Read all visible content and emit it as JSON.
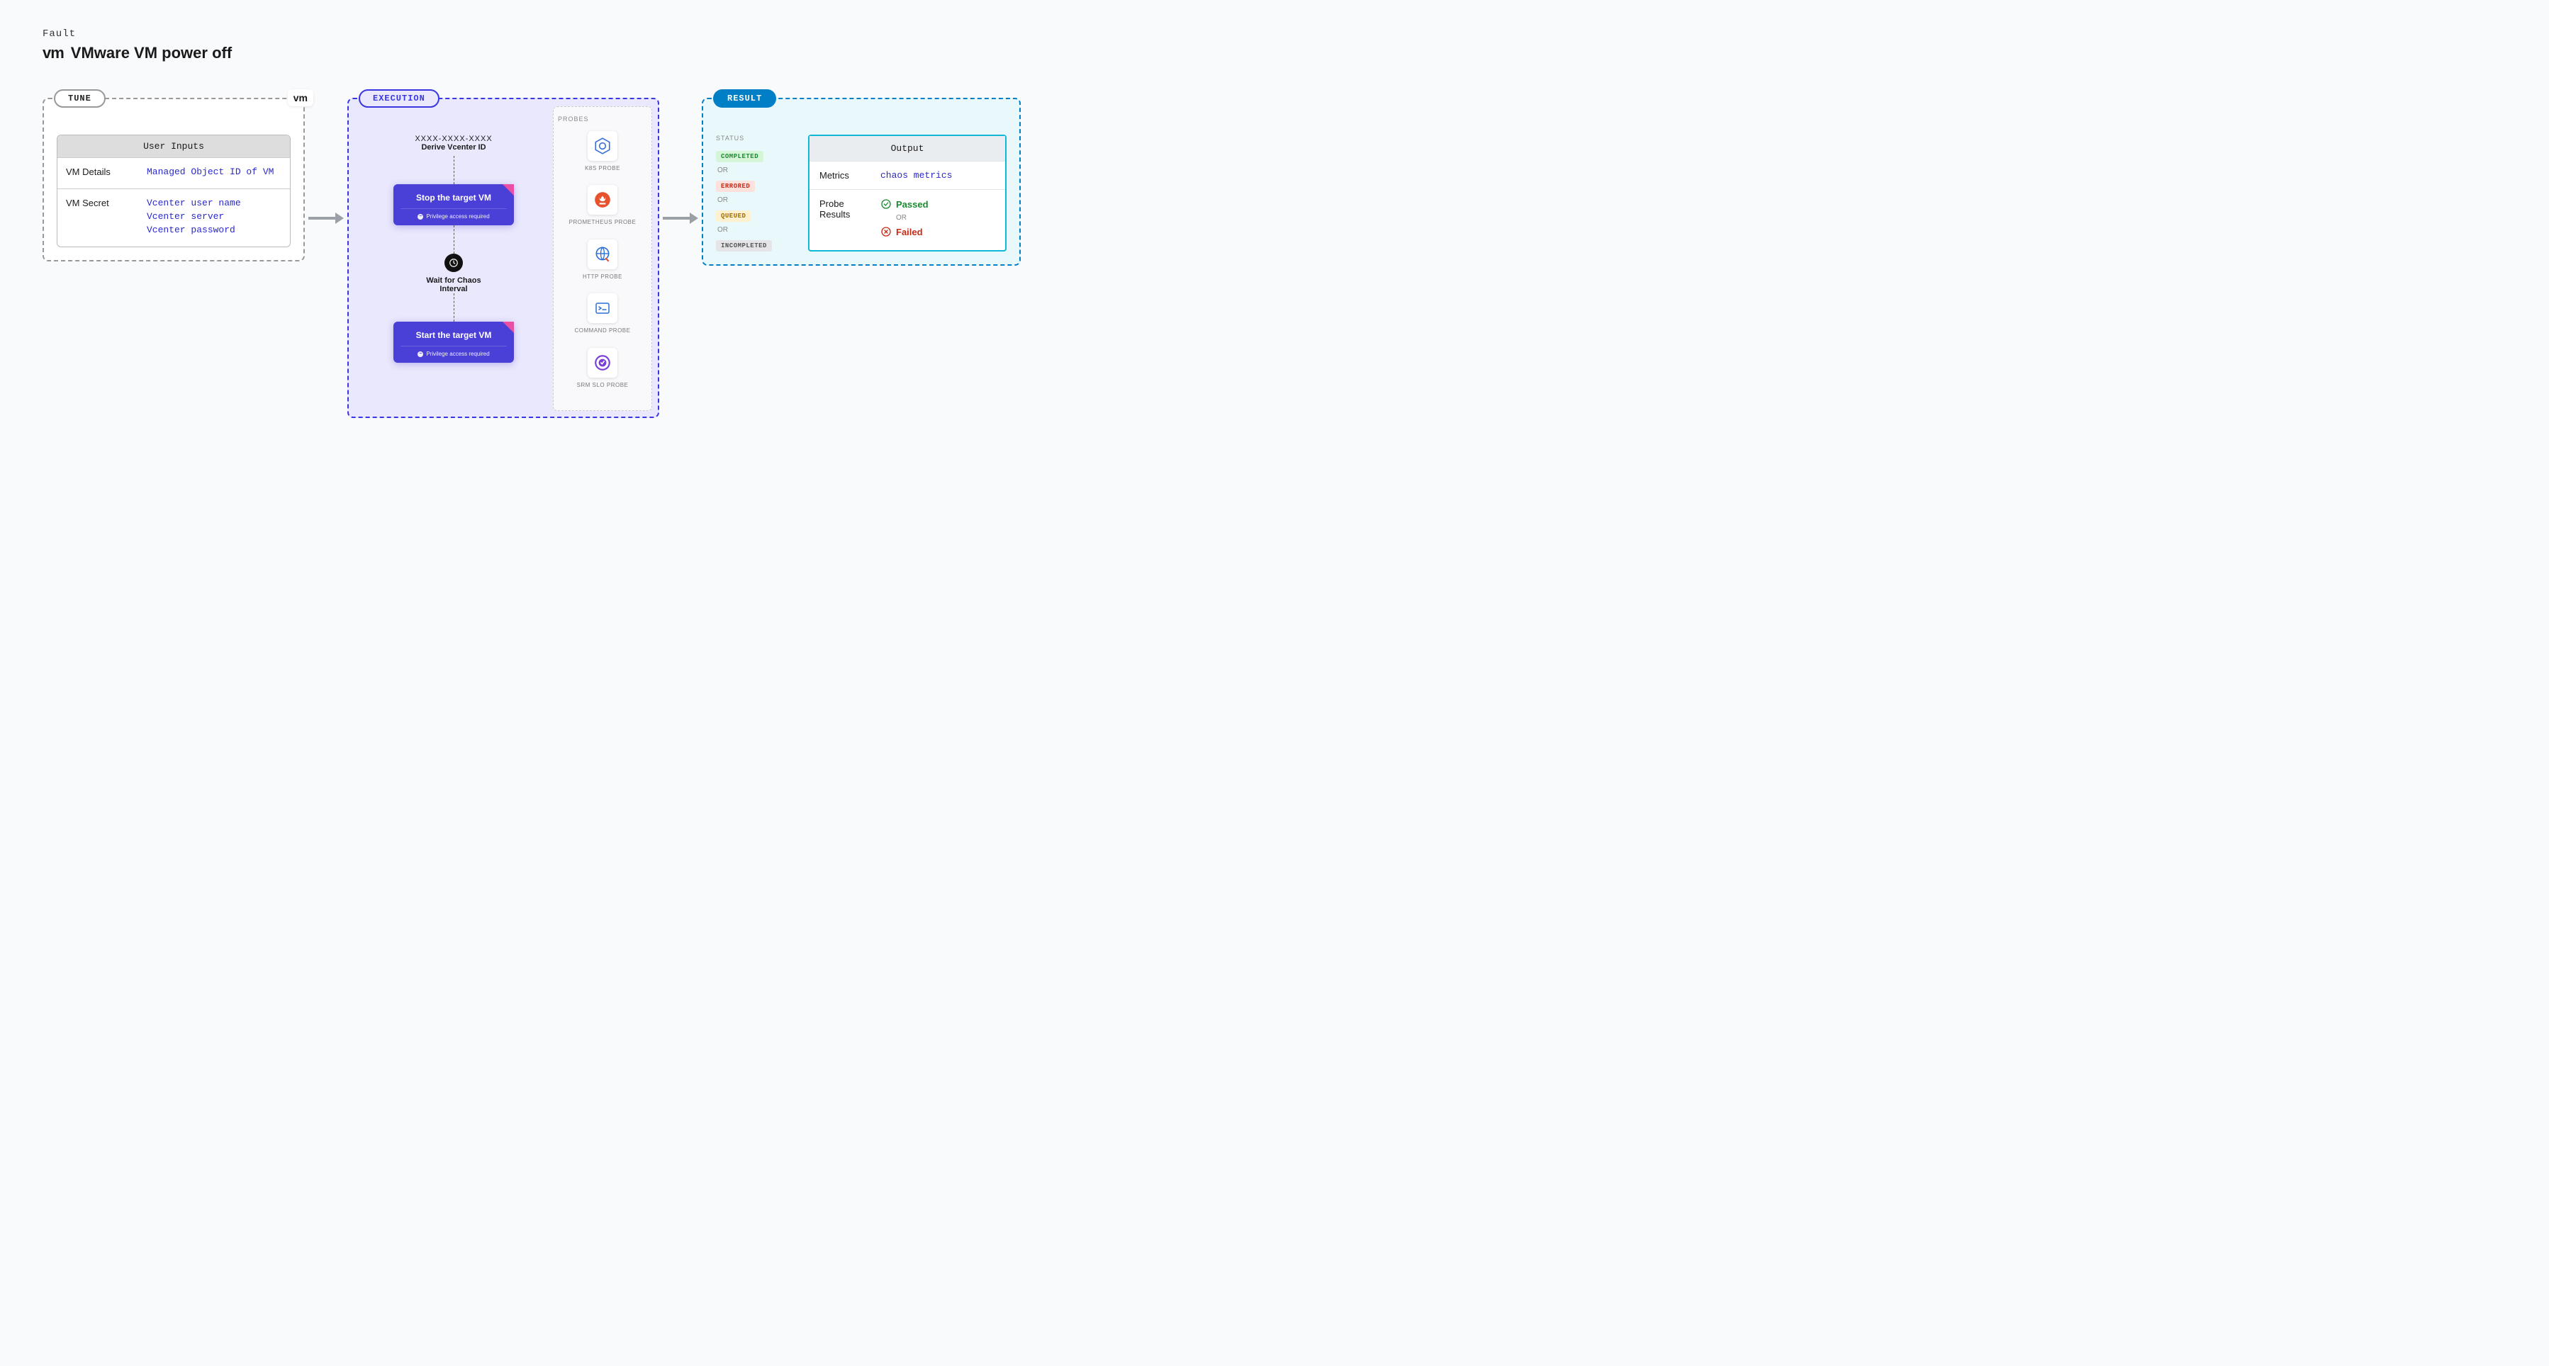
{
  "header": {
    "kicker": "Fault",
    "logo_text": "vm",
    "title": "VMware VM power off"
  },
  "tune": {
    "tag": "TUNE",
    "corner_logo": "vm",
    "inputs_title": "User Inputs",
    "rows": [
      {
        "key": "VM Details",
        "vals": [
          "Managed Object ID of VM"
        ]
      },
      {
        "key": "VM Secret",
        "vals": [
          "Vcenter user name",
          "Vcenter server",
          "Vcenter password"
        ]
      }
    ]
  },
  "execution": {
    "tag": "EXECUTION",
    "derive": {
      "mask": "XXXX-XXXX-XXXX",
      "label": "Derive Vcenter ID"
    },
    "step1": {
      "title": "Stop the target VM",
      "sub": "Privilege access required"
    },
    "wait": {
      "label": "Wait for Chaos Interval"
    },
    "step2": {
      "title": "Start the target VM",
      "sub": "Privilege access required"
    },
    "probes_title": "PROBES",
    "probes": [
      {
        "name": "k8s",
        "label": "K8S PROBE"
      },
      {
        "name": "prometheus",
        "label": "PROMETHEUS PROBE"
      },
      {
        "name": "http",
        "label": "HTTP PROBE"
      },
      {
        "name": "command",
        "label": "COMMAND PROBE"
      },
      {
        "name": "srm",
        "label": "SRM SLO PROBE"
      }
    ]
  },
  "result": {
    "tag": "RESULT",
    "status_head": "STATUS",
    "or": "OR",
    "statuses": {
      "completed": "COMPLETED",
      "errored": "ERRORED",
      "queued": "QUEUED",
      "incompleted": "INCOMPLETED"
    },
    "output_title": "Output",
    "metrics_key": "Metrics",
    "metrics_val": "chaos metrics",
    "probe_key": "Probe Results",
    "passed": "Passed",
    "failed": "Failed"
  }
}
